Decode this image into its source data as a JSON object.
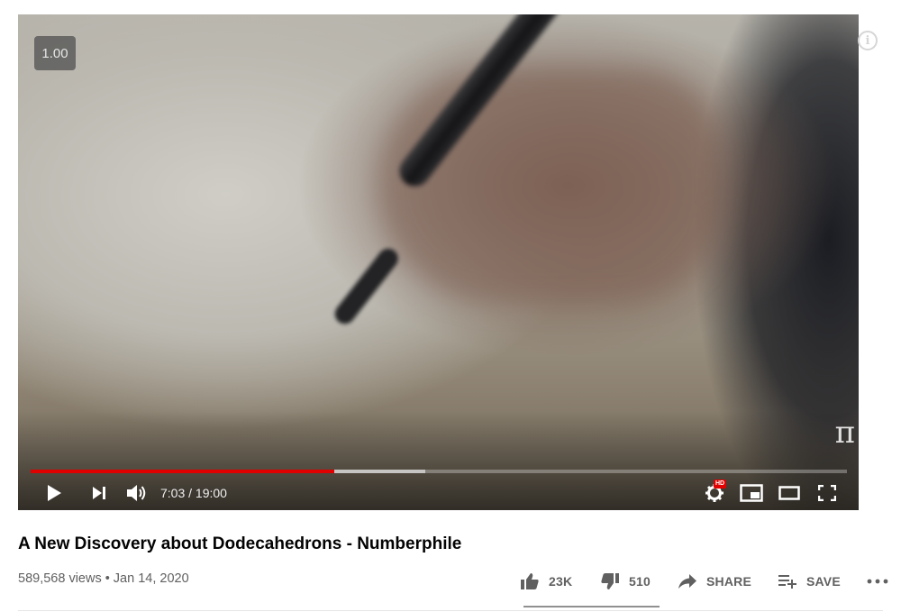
{
  "player": {
    "speed_badge": "1.00",
    "watermark": "π",
    "time_current": "7:03",
    "time_separator": " / ",
    "time_total": "19:00",
    "hd_badge": "HD",
    "progress_played_fraction": 0.372,
    "progress_buffered_fraction": 0.483,
    "icons": {
      "play": "play-icon",
      "next": "next-icon",
      "volume": "volume-icon",
      "settings": "settings-gear-icon",
      "miniplayer": "miniplayer-icon",
      "theater": "theater-mode-icon",
      "fullscreen": "fullscreen-icon",
      "info": "info-icon"
    },
    "accent_color": "#e00000"
  },
  "video": {
    "title": "A New Discovery about Dodecahedrons - Numberphile",
    "views": "589,568 views",
    "separator": "•",
    "date": "Jan 14, 2020"
  },
  "actions": {
    "likes": "23K",
    "dislikes": "510",
    "share_label": "SHARE",
    "save_label": "SAVE",
    "icons": {
      "like": "thumb-up-icon",
      "dislike": "thumb-down-icon",
      "share": "share-arrow-icon",
      "save": "playlist-add-icon",
      "more": "more-horizontal-icon"
    }
  }
}
